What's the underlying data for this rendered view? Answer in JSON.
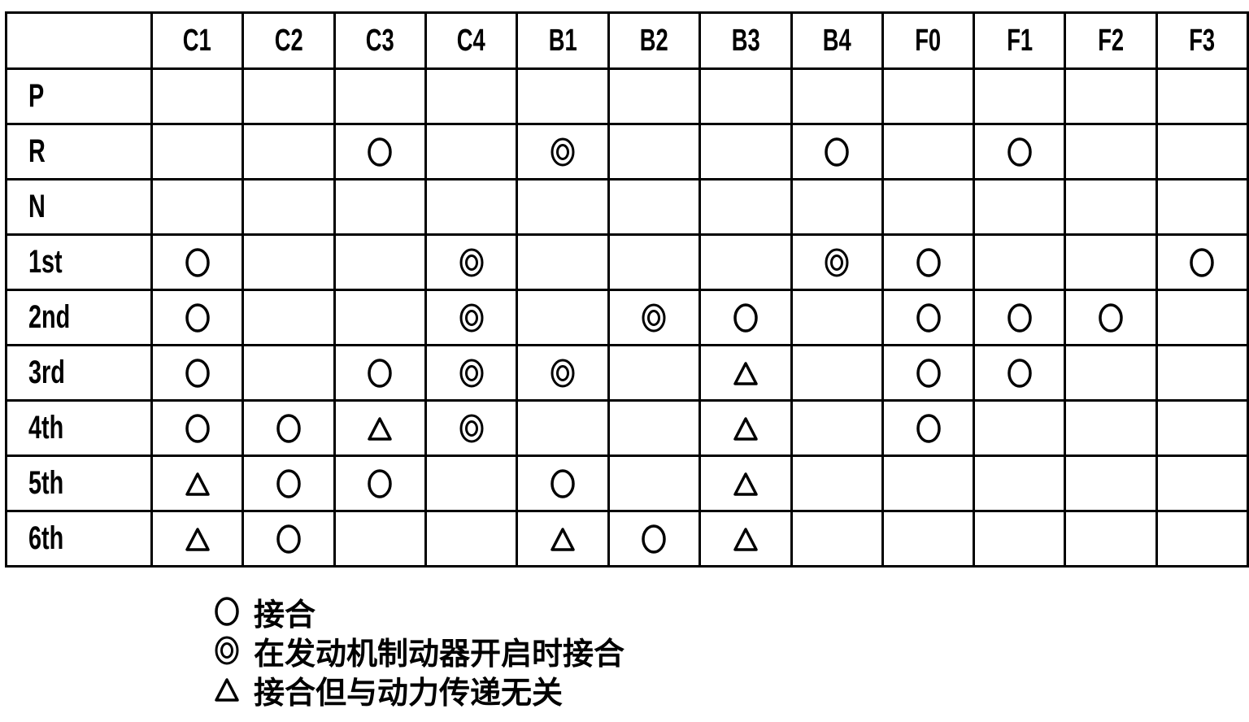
{
  "table": {
    "columns": [
      "",
      "C1",
      "C2",
      "C3",
      "C4",
      "B1",
      "B2",
      "B3",
      "B4",
      "F0",
      "F1",
      "F2",
      "F3"
    ],
    "rows": [
      {
        "label": "P",
        "cells": [
          "",
          "",
          "",
          "",
          "",
          "",
          "",
          "",
          "",
          "",
          "",
          ""
        ]
      },
      {
        "label": "R",
        "cells": [
          "",
          "",
          "circle",
          "",
          "double-circle",
          "",
          "",
          "circle",
          "",
          "circle",
          "",
          ""
        ]
      },
      {
        "label": "N",
        "cells": [
          "",
          "",
          "",
          "",
          "",
          "",
          "",
          "",
          "",
          "",
          "",
          ""
        ]
      },
      {
        "label": "1st",
        "cells": [
          "circle",
          "",
          "",
          "double-circle",
          "",
          "",
          "",
          "double-circle",
          "circle",
          "",
          "",
          "circle"
        ]
      },
      {
        "label": "2nd",
        "cells": [
          "circle",
          "",
          "",
          "double-circle",
          "",
          "double-circle",
          "circle",
          "",
          "circle",
          "circle",
          "circle",
          ""
        ]
      },
      {
        "label": "3rd",
        "cells": [
          "circle",
          "",
          "circle",
          "double-circle",
          "double-circle",
          "",
          "triangle",
          "",
          "circle",
          "circle",
          "",
          ""
        ]
      },
      {
        "label": "4th",
        "cells": [
          "circle",
          "circle",
          "triangle",
          "double-circle",
          "",
          "",
          "triangle",
          "",
          "circle",
          "",
          "",
          ""
        ]
      },
      {
        "label": "5th",
        "cells": [
          "triangle",
          "circle",
          "circle",
          "",
          "circle",
          "",
          "triangle",
          "",
          "",
          "",
          "",
          ""
        ]
      },
      {
        "label": "6th",
        "cells": [
          "triangle",
          "circle",
          "",
          "",
          "triangle",
          "circle",
          "triangle",
          "",
          "",
          "",
          "",
          ""
        ]
      }
    ]
  },
  "legend": [
    {
      "symbol": "circle",
      "text": "接合"
    },
    {
      "symbol": "double-circle",
      "text": "在发动机制动器开启时接合"
    },
    {
      "symbol": "triangle",
      "text": "接合但与动力传递无关"
    }
  ]
}
